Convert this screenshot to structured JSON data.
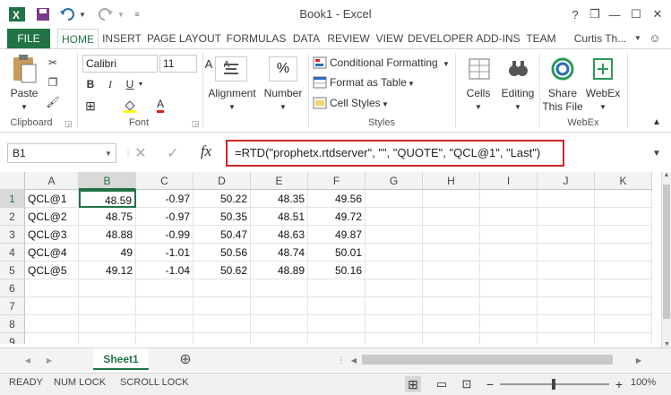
{
  "titlebar": {
    "title": "Book1 - Excel",
    "help": "?",
    "restore": "❐",
    "minimize": "—",
    "maximize": "☐",
    "close": "✕"
  },
  "tabs": [
    {
      "label": "FILE"
    },
    {
      "label": "HOME"
    },
    {
      "label": "INSERT"
    },
    {
      "label": "PAGE LAYOUT"
    },
    {
      "label": "FORMULAS"
    },
    {
      "label": "DATA"
    },
    {
      "label": "REVIEW"
    },
    {
      "label": "VIEW"
    },
    {
      "label": "DEVELOPER"
    },
    {
      "label": "ADD-INS"
    },
    {
      "label": "TEAM"
    }
  ],
  "user": "Curtis Th...",
  "ribbon": {
    "clipboard": {
      "paste": "Paste",
      "group": "Clipboard"
    },
    "font": {
      "name": "Calibri",
      "size": "11",
      "group": "Font",
      "bold": "B",
      "italic": "I",
      "underline": "U",
      "grow": "A",
      "shrink": "A",
      "font_color_letter": "A"
    },
    "alignment": "Alignment",
    "number": "Number",
    "number_symbol": "%",
    "styles": {
      "conditional": "Conditional Formatting",
      "format_table": "Format as Table",
      "cell_styles": "Cell Styles",
      "group": "Styles"
    },
    "cells": "Cells",
    "editing": "Editing",
    "webex": {
      "share_line1": "Share",
      "share_line2": "This File",
      "webex": "WebEx",
      "group": "WebEx"
    }
  },
  "formula_bar": {
    "name_box": "B1",
    "fx": "fx",
    "formula": "=RTD(\"prophetx.rtdserver\", \"\", \"QUOTE\", \"QCL@1\", \"Last\")"
  },
  "grid": {
    "columns": [
      "A",
      "B",
      "C",
      "D",
      "E",
      "F",
      "G",
      "H",
      "I",
      "J",
      "K"
    ],
    "rows": [
      "1",
      "2",
      "3",
      "4",
      "5",
      "6",
      "7",
      "8",
      "9"
    ],
    "data": [
      [
        "QCL@1",
        "48.59",
        "-0.97",
        "50.22",
        "48.35",
        "49.56"
      ],
      [
        "QCL@2",
        "48.75",
        "-0.97",
        "50.35",
        "48.51",
        "49.72"
      ],
      [
        "QCL@3",
        "48.88",
        "-0.99",
        "50.47",
        "48.63",
        "49.87"
      ],
      [
        "QCL@4",
        "49",
        "-1.01",
        "50.56",
        "48.74",
        "50.01"
      ],
      [
        "QCL@5",
        "49.12",
        "-1.04",
        "50.62",
        "48.89",
        "50.16"
      ]
    ],
    "selected_cell": "B1"
  },
  "sheets": {
    "active": "Sheet1",
    "add": "⊕",
    "prev": "◀",
    "next": "▶"
  },
  "status": {
    "ready": "READY",
    "num_lock": "NUM LOCK",
    "scroll_lock": "SCROLL LOCK",
    "zoom": "100%",
    "zoom_minus": "−",
    "zoom_plus": "+"
  },
  "colors": {
    "accent": "#217346",
    "highlight_border": "#d12626",
    "header_bg": "#f3f3f3"
  },
  "icons": [
    "excel-icon",
    "save-icon",
    "undo-icon",
    "redo-icon",
    "paste-icon",
    "cut-icon",
    "copy-icon",
    "format-painter-icon",
    "alignment-icon",
    "number-icon",
    "conditional-formatting-icon",
    "format-table-icon",
    "cell-styles-icon",
    "cells-icon",
    "editing-icon",
    "share-icon",
    "webex-icon",
    "cancel-icon",
    "enter-icon"
  ]
}
